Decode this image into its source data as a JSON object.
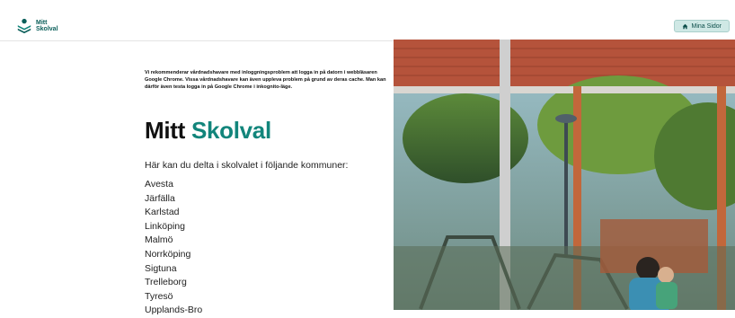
{
  "header": {
    "logo_line1": "Mitt",
    "logo_line2": "Skolval",
    "account_button": "Mina Sidor"
  },
  "main": {
    "notice": "Vi rekommenderar vårdnadshavare med inloggningsproblem att logga in på datorn i webbläsaren Google Chrome. Vissa vårdnadshavare kan även uppleva problem på grund av deras cache. Man kan därför även testa logga in på Google Chrome i inkognito-läge.",
    "title_part1": "Mitt",
    "title_part2": "Skolval",
    "intro": "Här kan du delta i skolvalet i följande kommuner:",
    "municipalities": [
      "Avesta",
      "Järfälla",
      "Karlstad",
      "Linköping",
      "Malmö",
      "Norrköping",
      "Sigtuna",
      "Trelleborg",
      "Tyresö",
      "Upplands-Bro"
    ]
  },
  "colors": {
    "accent": "#12857b",
    "brand": "#0b5f5a",
    "button_bg": "#cfe8e5"
  },
  "icons": {
    "logo": "mitt-skolval-logo-icon",
    "home": "home-icon"
  }
}
